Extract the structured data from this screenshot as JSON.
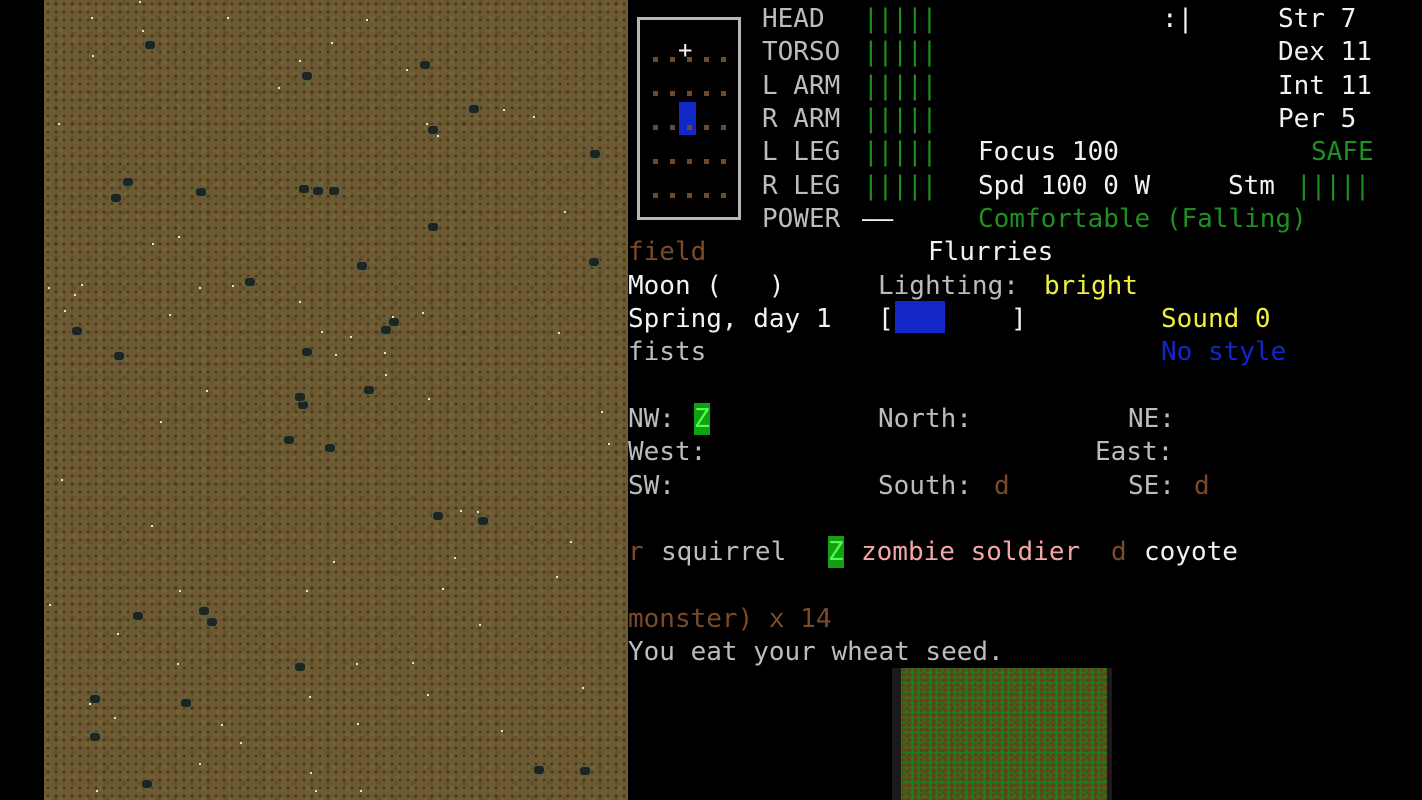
{
  "body_parts": [
    {
      "label": "HEAD",
      "health": "|||||"
    },
    {
      "label": "TORSO",
      "health": "|||||"
    },
    {
      "label": "L ARM",
      "health": "|||||"
    },
    {
      "label": "R ARM",
      "health": "|||||"
    },
    {
      "label": "L LEG",
      "health": "|||||"
    },
    {
      "label": "R LEG",
      "health": "|||||"
    },
    {
      "label": "POWER",
      "health": "——"
    }
  ],
  "face": ":|",
  "stats": {
    "str": "Str 7",
    "dex": "Dex 11",
    "int": "Int 11",
    "per": "Per 5"
  },
  "safe_mode": "SAFE",
  "focus": "Focus 100",
  "speed": "Spd 100 0 W",
  "stamina_label": "Stm",
  "stamina_bar": "|||||",
  "temperature": "Comfortable (Falling)",
  "location": "field",
  "weather": "Flurries",
  "moon": "Moon (   )",
  "lighting_label": "Lighting:",
  "lighting_value": "bright",
  "date": "Spring, day 1",
  "time_open": "[",
  "time_close": "]",
  "sound": "Sound 0",
  "weapon": "fists",
  "style": "No style",
  "compass": {
    "nw": "NW:",
    "nw_glyph": "Z",
    "north": "North:",
    "ne": "NE:",
    "west": "West:",
    "east": "East:",
    "sw": "SW:",
    "south": "South:",
    "south_glyph": "d",
    "se": "SE:",
    "se_glyph": "d"
  },
  "monsters": [
    {
      "glyph": "r",
      "name": "squirrel"
    },
    {
      "glyph": "Z",
      "name": "zombie soldier"
    },
    {
      "glyph": "d",
      "name": "coyote"
    }
  ],
  "messages": [
    "monster) x 14",
    "You eat your wheat seed."
  ],
  "player_glyph": "+",
  "colors": {
    "health": "#1f8f1f",
    "safe": "#1f8f1f",
    "lighting": "#f0ef40",
    "style": "#1326c8",
    "map_ground": "#6e5a32",
    "minimap": "#1b7d1b"
  }
}
